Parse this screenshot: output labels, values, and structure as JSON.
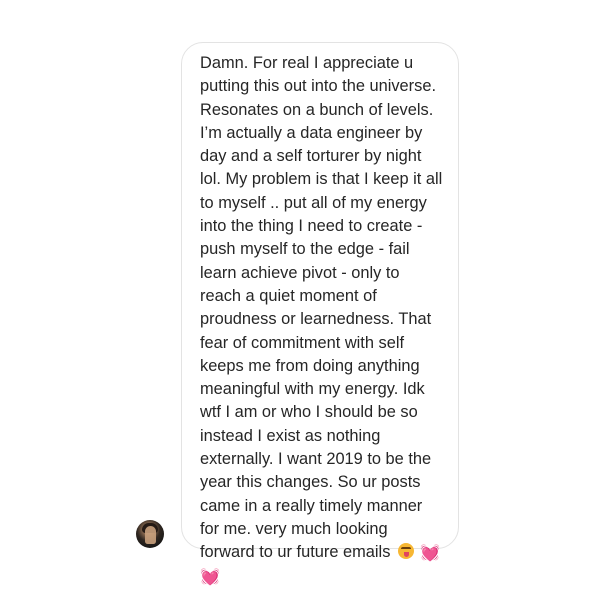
{
  "message": {
    "lines": [
      "Damn. For real I appreciate u",
      "putting this out into the universe.",
      "Resonates on a bunch of levels.",
      "I’m actually a data engineer by",
      "day and a self torturer by night",
      "lol. My problem is that I keep it all",
      "to myself .. put all of my energy",
      "into the thing I need to create -",
      "push myself to the edge - fail",
      "learn achieve pivot  - only to",
      "reach a quiet moment of",
      "proudness or learnedness. That",
      "fear of commitment with self",
      "keeps me from doing anything",
      "meaningful with my energy. Idk",
      "wtf I am or who I should be so",
      "instead I exist as nothing",
      "externally. I want 2019 to be the",
      "year this changes. So ur posts",
      "came in a really timely manner",
      "for me. very much looking",
      "forward to ur future emails"
    ],
    "emojis": {
      "grin_icon": "squinting-face-with-tongue-icon",
      "heart": "💓",
      "heart_icon": "beating-heart-icon"
    }
  },
  "sender": {
    "avatar_icon": "profile-avatar"
  },
  "colors": {
    "text": "#262626",
    "bubble_border": "#e3e3e3",
    "heart": "#ff4fa3"
  }
}
